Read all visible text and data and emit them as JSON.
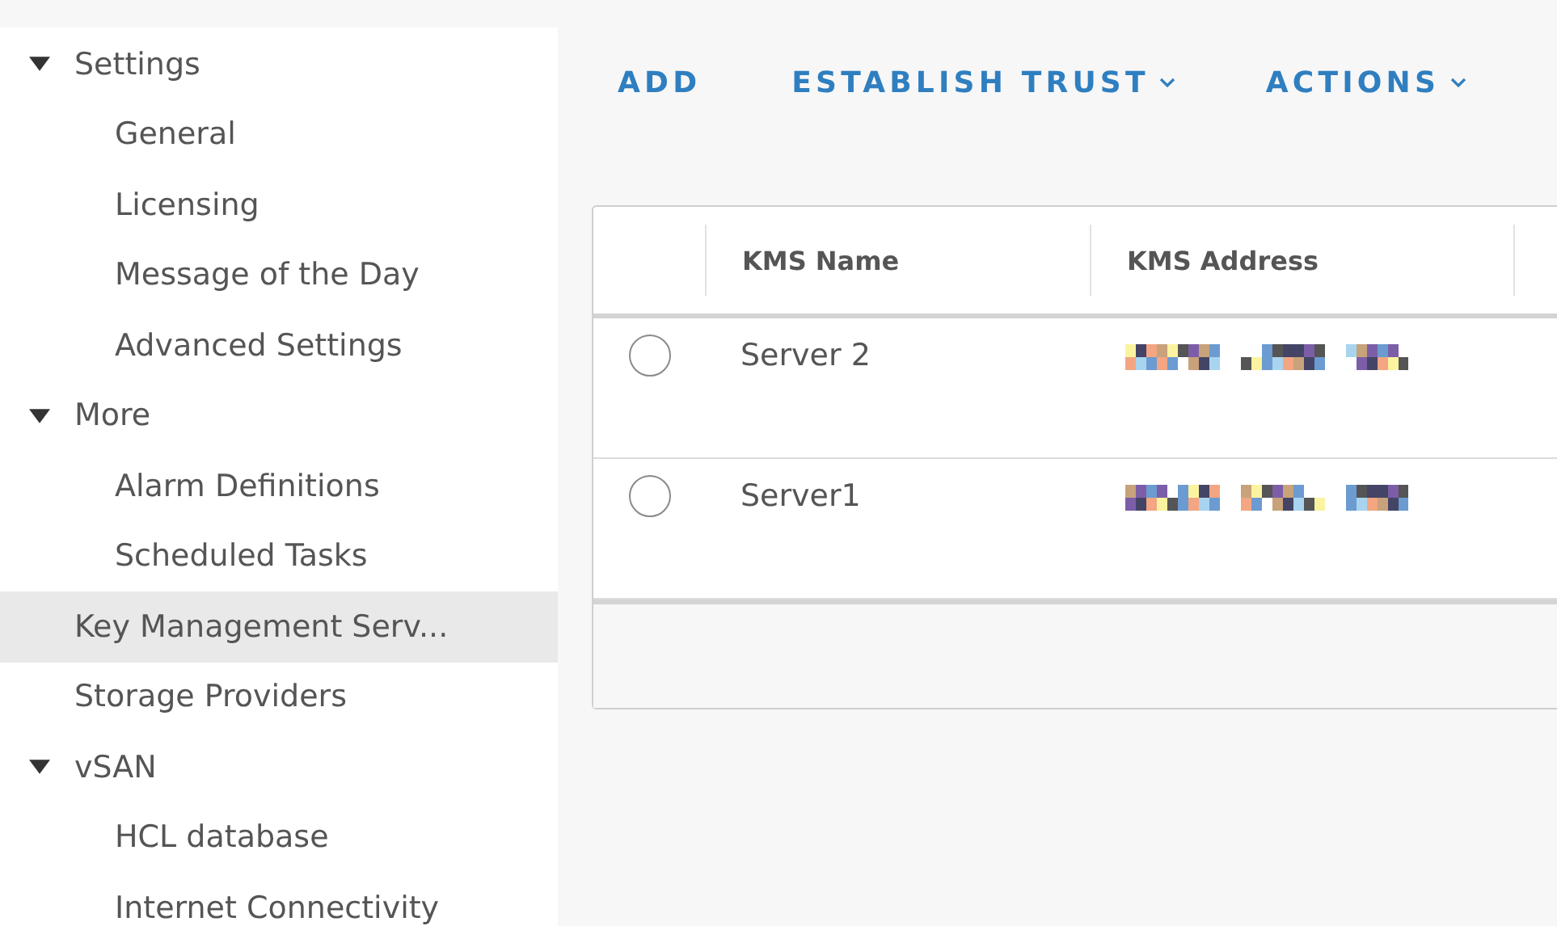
{
  "sidebar": {
    "items": [
      {
        "kind": "group",
        "label": "Settings",
        "expanded": true,
        "selected": false,
        "children": [
          {
            "label": "General",
            "selected": false
          },
          {
            "label": "Licensing",
            "selected": false
          },
          {
            "label": "Message of the Day",
            "selected": false
          },
          {
            "label": "Advanced Settings",
            "selected": false
          }
        ]
      },
      {
        "kind": "group",
        "label": "More",
        "expanded": true,
        "selected": false,
        "children": [
          {
            "label": "Alarm Definitions",
            "selected": false
          },
          {
            "label": "Scheduled Tasks",
            "selected": false
          }
        ]
      },
      {
        "kind": "link",
        "label": "Key Management Serv...",
        "selected": true
      },
      {
        "kind": "link",
        "label": "Storage Providers",
        "selected": false
      },
      {
        "kind": "group",
        "label": "vSAN",
        "expanded": true,
        "selected": false,
        "children": [
          {
            "label": "HCL database",
            "selected": false
          },
          {
            "label": "Internet Connectivity",
            "selected": false
          }
        ]
      }
    ]
  },
  "toolbar": [
    {
      "label": "ADD",
      "dropdown": false
    },
    {
      "label": "ESTABLISH TRUST",
      "dropdown": true
    },
    {
      "label": "ACTIONS",
      "dropdown": true
    }
  ],
  "table": {
    "columns": [
      "KMS Name",
      "KMS Address"
    ],
    "rows": [
      {
        "name": "Server 2",
        "selected": false
      },
      {
        "name": "Server1",
        "selected": false
      }
    ]
  }
}
